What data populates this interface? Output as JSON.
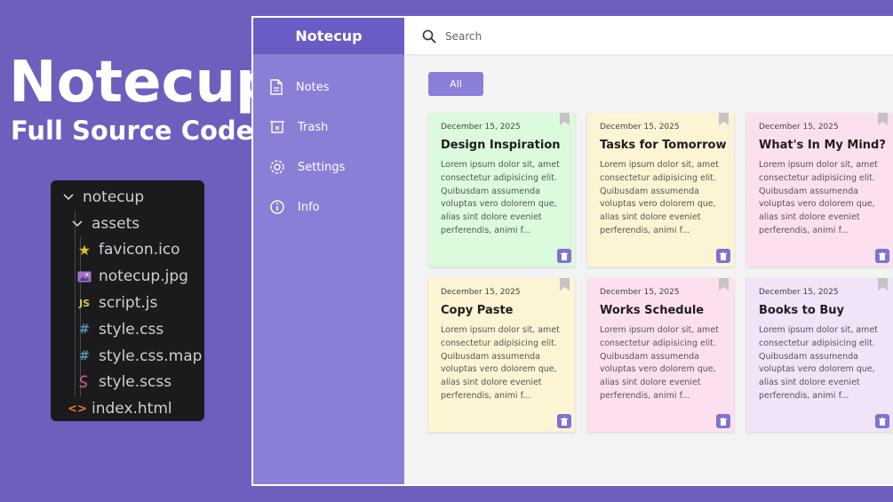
{
  "promo": {
    "title": "Notecup",
    "subtitle": "Full Source Code"
  },
  "file_tree": [
    {
      "label": "notecup",
      "icon": "chevron-down-icon",
      "level": 0
    },
    {
      "label": "assets",
      "icon": "chevron-down-icon",
      "level": 1
    },
    {
      "label": "favicon.ico",
      "icon": "star-icon",
      "level": 2,
      "icon_color": "#e5c22b"
    },
    {
      "label": "notecup.jpg",
      "icon": "image-icon",
      "level": 2,
      "icon_color": "#a274c9"
    },
    {
      "label": "script.js",
      "icon": "js-icon",
      "level": 2,
      "icon_color": "#d8c44a"
    },
    {
      "label": "style.css",
      "icon": "hash-icon",
      "level": 2,
      "icon_color": "#519aba"
    },
    {
      "label": "style.css.map",
      "icon": "hash-icon",
      "level": 2,
      "icon_color": "#519aba"
    },
    {
      "label": "style.scss",
      "icon": "sass-icon",
      "level": 2,
      "icon_color": "#c6538c"
    },
    {
      "label": "index.html",
      "icon": "html-icon",
      "level": 1,
      "icon_color": "#e37933"
    }
  ],
  "app": {
    "title": "Notecup",
    "search_placeholder": "Search",
    "filter_label": "All",
    "nav": [
      {
        "label": "Notes",
        "icon": "file-icon"
      },
      {
        "label": "Trash",
        "icon": "trash-icon"
      },
      {
        "label": "Settings",
        "icon": "gear-icon"
      },
      {
        "label": "Info",
        "icon": "info-icon"
      }
    ]
  },
  "notes": [
    {
      "date": "December 15, 2025",
      "title": "Design Inspiration",
      "body": "Lorem ipsum dolor sit, amet consectetur adipisicing elit. Quibusdam assumenda voluptas vero dolorem que, alias sint dolore eveniet perferendis, animi f...",
      "color": "#dcfadc"
    },
    {
      "date": "December 15, 2025",
      "title": "Tasks for Tomorrow",
      "body": "Lorem ipsum dolor sit, amet consectetur adipisicing elit. Quibusdam assumenda voluptas vero dolorem que, alias sint dolore eveniet perferendis, animi f...",
      "color": "#fdf4d4"
    },
    {
      "date": "December 15, 2025",
      "title": "What's In My Mind?",
      "body": "Lorem ipsum dolor sit, amet consectetur adipisicing elit. Quibusdam assumenda voluptas vero dolorem que, alias sint dolore eveniet perferendis, animi f...",
      "color": "#fde0ef"
    },
    {
      "date": "December 15, 2025",
      "title": "Copy Paste",
      "body": "Lorem ipsum dolor sit, amet consectetur adipisicing elit. Quibusdam assumenda voluptas vero dolorem que, alias sint dolore eveniet perferendis, animi f...",
      "color": "#fdf4d4"
    },
    {
      "date": "December 15, 2025",
      "title": "Works Schedule",
      "body": "Lorem ipsum dolor sit, amet consectetur adipisicing elit. Quibusdam assumenda voluptas vero dolorem que, alias sint dolore eveniet perferendis, animi f...",
      "color": "#fde0ef"
    },
    {
      "date": "December 15, 2025",
      "title": "Books to Buy",
      "body": "Lorem ipsum dolor sit, amet consectetur adipisicing elit. Quibusdam assumenda voluptas vero dolorem que, alias sint dolore eveniet perferendis, animi f...",
      "color": "#f1e3f8"
    }
  ]
}
